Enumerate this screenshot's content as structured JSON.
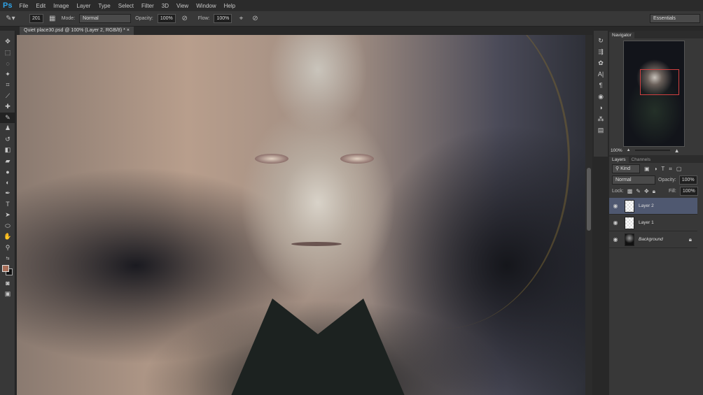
{
  "app": {
    "logo": "Ps",
    "menus": [
      "File",
      "Edit",
      "Image",
      "Layer",
      "Type",
      "Select",
      "Filter",
      "3D",
      "View",
      "Window",
      "Help"
    ]
  },
  "options": {
    "brush_size": "201",
    "mode_label": "Mode:",
    "mode": "Normal",
    "opacity_label": "Opacity:",
    "opacity": "100%",
    "flow_label": "Flow:",
    "flow": "100%",
    "workspace": "Essentials"
  },
  "document": {
    "tab": "Quiet place30.psd @ 100% (Layer 2, RGB/8) *",
    "close": "×"
  },
  "navigator": {
    "title": "Navigator",
    "zoom": "100%"
  },
  "layers_panel": {
    "tabs": [
      "Layers",
      "Channels"
    ],
    "filter": "Kind",
    "blend": "Normal",
    "opacity_label": "Opacity:",
    "opacity": "100%",
    "lock_label": "Lock:",
    "fill_label": "Fill:",
    "fill": "100%",
    "layers": [
      {
        "name": "Layer 2",
        "selected": true
      },
      {
        "name": "Layer 1",
        "selected": false
      },
      {
        "name": "Background",
        "selected": false,
        "locked": true
      }
    ]
  },
  "colors": {
    "accent": "#2fa3e6",
    "foreground": "#a86e58",
    "background": "#111111",
    "selected_layer": "#4f5870"
  }
}
